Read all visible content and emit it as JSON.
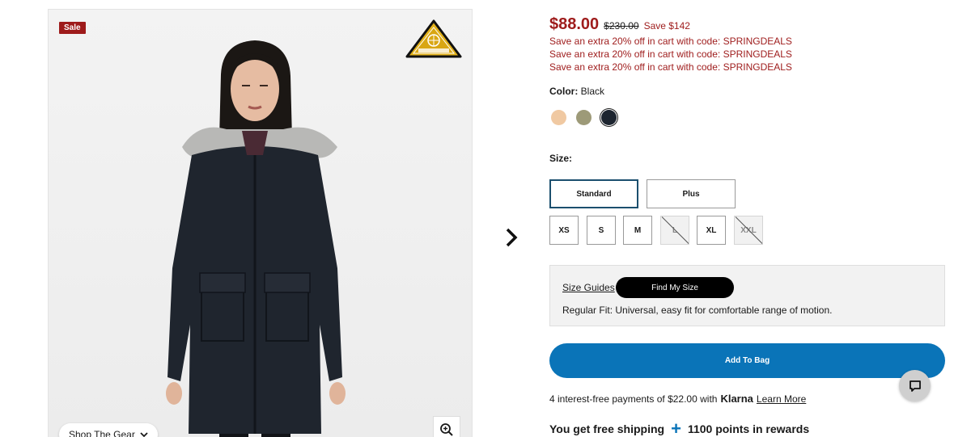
{
  "image": {
    "sale_badge": "Sale",
    "shop_gear_label": "Shop The Gear",
    "badge_icon": "omni-heat-infinity-badge-icon",
    "zoom_icon": "zoom-in-icon"
  },
  "pricing": {
    "current_price": "$88.00",
    "original_price": "$230.00",
    "savings": "Save $142",
    "promos": [
      "Save an extra 20% off in cart with code: SPRINGDEALS",
      "Save an extra 20% off in cart with code: SPRINGDEALS",
      "Save an extra 20% off in cart with code: SPRINGDEALS"
    ]
  },
  "color": {
    "label": "Color:",
    "selected": "Black",
    "swatches": [
      {
        "name": "peach",
        "hex": "#f0c9a2",
        "selected": false
      },
      {
        "name": "olive",
        "hex": "#9d9a78",
        "selected": false
      },
      {
        "name": "black",
        "hex": "#1d2530",
        "selected": true
      }
    ]
  },
  "size": {
    "label": "Size:",
    "fits": [
      {
        "label": "Standard",
        "selected": true
      },
      {
        "label": "Plus",
        "selected": false
      }
    ],
    "sizes": [
      {
        "label": "XS",
        "available": true
      },
      {
        "label": "S",
        "available": true
      },
      {
        "label": "M",
        "available": true
      },
      {
        "label": "L",
        "available": false
      },
      {
        "label": "XL",
        "available": true
      },
      {
        "label": "XXL",
        "available": false
      }
    ]
  },
  "fit_info": {
    "size_guides": "Size Guides",
    "find_my_size": "Find My Size",
    "description": "Regular Fit: Universal, easy fit for comfortable range of motion."
  },
  "cart": {
    "add_to_bag": "Add To Bag"
  },
  "financing": {
    "text": "4 interest-free payments of $22.00 with",
    "provider": "Klarna",
    "learn_more": "Learn More"
  },
  "shipping": {
    "free_shipping": "You get free shipping",
    "rewards": "1100 points in rewards"
  },
  "colors": {
    "sale_red": "#9e1b1b",
    "primary_blue": "#0a74b8",
    "fit_active_border": "#1b4f6e"
  }
}
